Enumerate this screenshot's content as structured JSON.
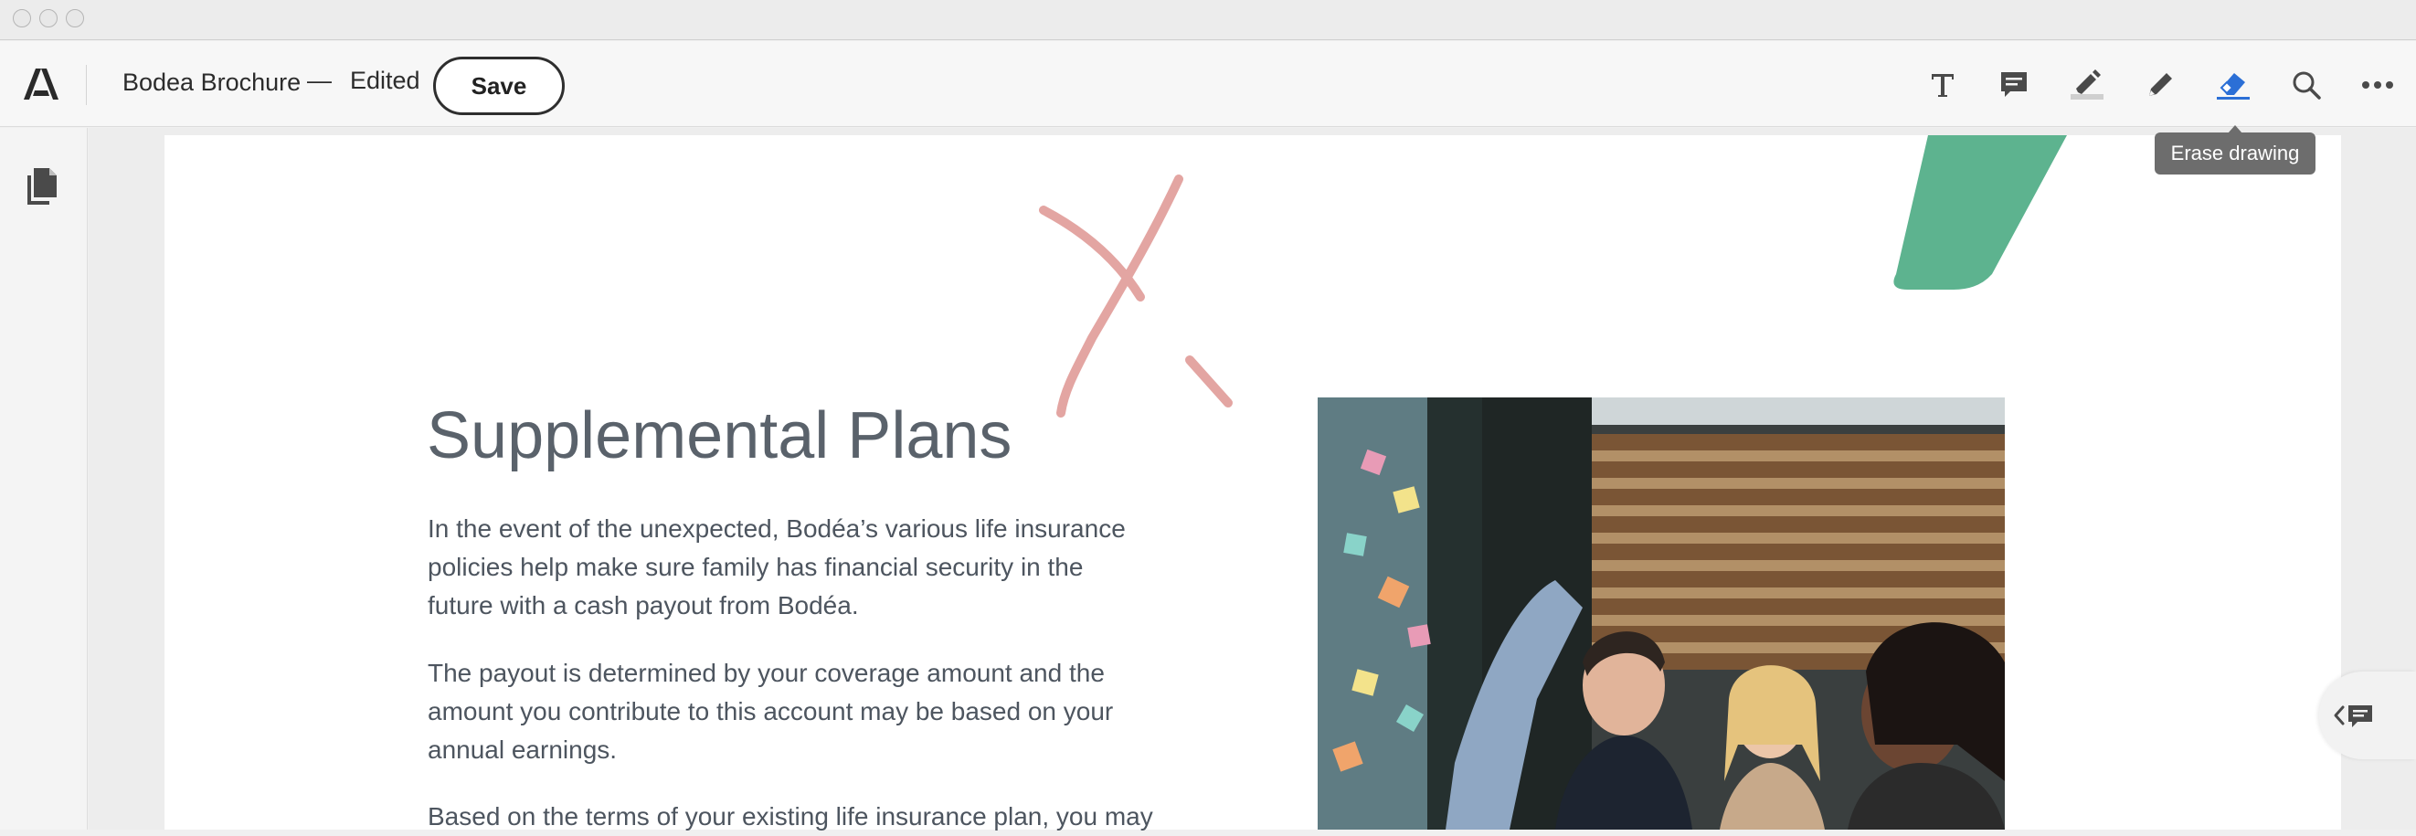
{
  "window": {
    "controls": [
      "close",
      "minimize",
      "zoom"
    ]
  },
  "toolbar": {
    "app_icon": "adobe-acrobat-logo",
    "doc_title": "Bodea Brochure",
    "separator": "—",
    "status": "Edited",
    "save_label": "Save",
    "tools": [
      {
        "name": "text-tool",
        "icon": "T-icon"
      },
      {
        "name": "comment-tool",
        "icon": "speech-bubble-icon"
      },
      {
        "name": "highlight-tool",
        "icon": "highlighter-icon"
      },
      {
        "name": "draw-tool",
        "icon": "pencil-icon"
      },
      {
        "name": "erase-tool",
        "icon": "eraser-icon",
        "active": true
      },
      {
        "name": "search-tool",
        "icon": "magnifier-icon"
      },
      {
        "name": "more-tool",
        "icon": "ellipsis-icon"
      }
    ],
    "tooltip": "Erase drawing"
  },
  "sidebar": {
    "icon": "pages-icon"
  },
  "document": {
    "heading": "Supplemental Plans",
    "paragraphs": [
      [
        "In the event of the unexpected, Bodéa’s various life insurance",
        "policies help make sure family has financial security in the",
        "future with a cash payout from Bodéa."
      ],
      [
        "The payout is determined by your coverage amount and the",
        "amount you contribute to this account may be based on your",
        "annual earnings."
      ],
      [
        "Based on the terms of your existing life insurance plan, you may"
      ]
    ],
    "photo_alt": "office team photo"
  },
  "colors": {
    "accent_blue": "#2b6fd6",
    "ink_stroke": "#e3a5a2",
    "green_shape": "#5db38f",
    "heading_gray": "#5a626b"
  }
}
